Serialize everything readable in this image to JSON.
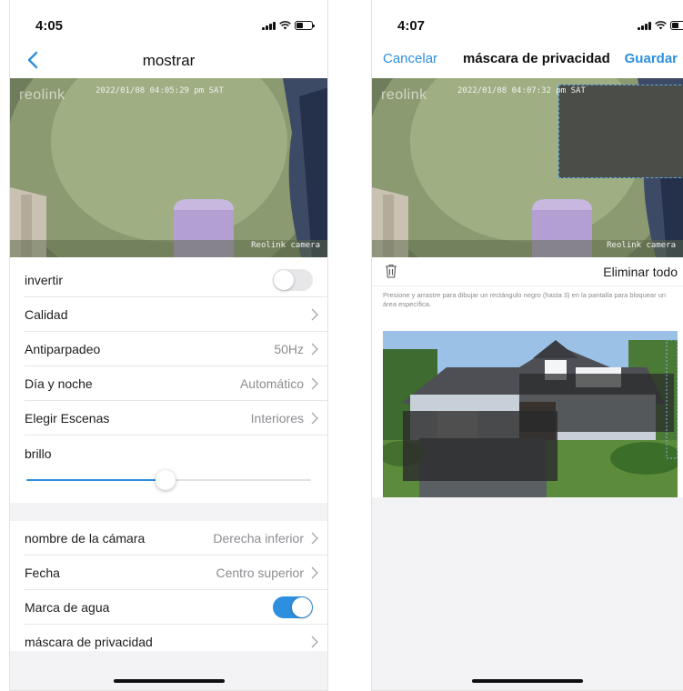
{
  "left_screen": {
    "status_time": "4:05",
    "nav_title": "mostrar",
    "camera": {
      "logo": "reolink",
      "timestamp": "2022/01/08 04:05:29 pm SAT",
      "camera_label": "Reolink camera"
    },
    "rows": [
      {
        "label": "invertir",
        "value": "",
        "control": "toggle",
        "on": false
      },
      {
        "label": "Calidad",
        "value": "",
        "control": "chevron"
      },
      {
        "label": "Antiparpadeo",
        "value": "50Hz",
        "control": "chevron"
      },
      {
        "label": "Día y noche",
        "value": "Automático",
        "control": "chevron"
      },
      {
        "label": "Elegir Escenas",
        "value": "Interiores",
        "control": "chevron"
      }
    ],
    "brightness": {
      "label": "brillo",
      "level": 0.49
    },
    "rows2": [
      {
        "label": "nombre de la cámara",
        "value": "Derecha inferior",
        "control": "chevron"
      },
      {
        "label": "Fecha",
        "value": "Centro superior",
        "control": "chevron"
      },
      {
        "label": "Marca de agua",
        "value": "",
        "control": "toggle",
        "on": true
      },
      {
        "label": "máscara de privacidad",
        "value": "",
        "control": "chevron"
      }
    ]
  },
  "right_screen": {
    "status_time": "4:07",
    "cancel_label": "Cancelar",
    "nav_title": "máscara de privacidad",
    "save_label": "Guardar",
    "camera": {
      "logo": "reolink",
      "timestamp": "2022/01/08 04:07:32 pm SAT",
      "camera_label": "Reolink camera"
    },
    "delete_all_label": "Eliminar todo",
    "instructions": "Presione y arrastre para dibujar un rectángulo negro (hasta 3) en la pantalla para bloquear un área específica."
  },
  "colors": {
    "accent": "#2d8fde",
    "toggle_off": "#e7e7ea",
    "secondary_text": "#8d8d92"
  },
  "icons": [
    "back-chevron-icon",
    "signal-icon",
    "wifi-icon",
    "battery-icon",
    "chevron-right-icon",
    "trash-icon"
  ]
}
